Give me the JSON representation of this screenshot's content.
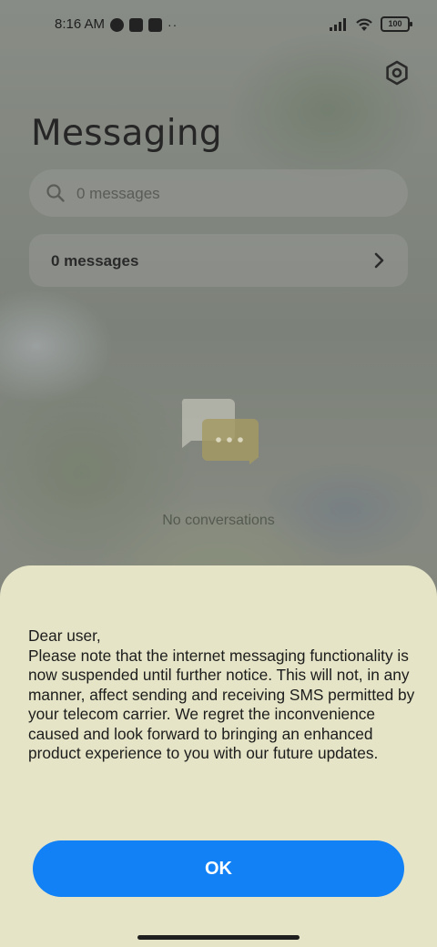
{
  "status_bar": {
    "time": "8:16 AM",
    "battery": "100",
    "icons": [
      "notification-icon",
      "square-app-icon",
      "upload-icon",
      "more-dots-icon",
      "signal-icon",
      "wifi-icon",
      "battery-icon"
    ],
    "more": "··"
  },
  "header": {
    "title": "Messaging",
    "settings_icon": "settings-hex-icon"
  },
  "search": {
    "placeholder": "0 messages",
    "value": ""
  },
  "messages_row": {
    "label": "0 messages"
  },
  "empty_state": {
    "icon": "chat-bubbles-icon",
    "text": "No conversations"
  },
  "dialog": {
    "greeting": "Dear user,",
    "body": "Please note that the internet messaging functionality is now suspended until further notice. This will not, in any manner, affect sending and receiving SMS permitted by your telecom carrier. We regret the inconvenience caused and look forward to bringing an enhanced product experience to you with our future updates.",
    "ok_label": "OK"
  },
  "colors": {
    "sheet_background": "#e5e4c6",
    "accent_button": "#1281f6"
  }
}
